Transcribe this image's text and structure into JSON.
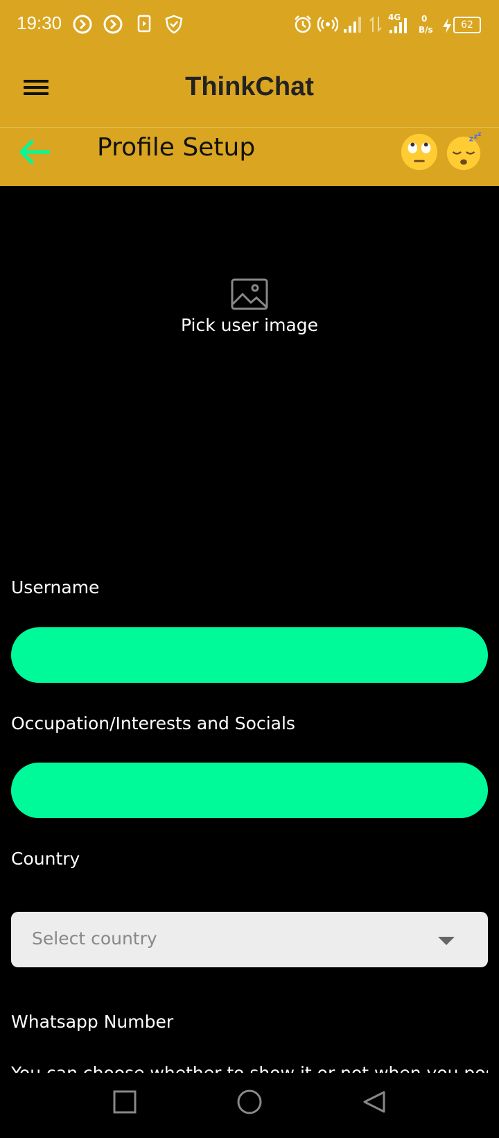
{
  "status_bar": {
    "time": "19:30",
    "network_type": "4G",
    "speed_value": "0",
    "speed_unit": "B/s",
    "battery": "62"
  },
  "app_bar": {
    "title": "ThinkChat"
  },
  "sub_bar": {
    "title": "Profile Setup"
  },
  "image_picker": {
    "label": "Pick user image"
  },
  "form": {
    "username_label": "Username",
    "username_value": "",
    "occupation_label": "Occupation/Interests and Socials",
    "occupation_value": "",
    "country_label": "Country",
    "country_placeholder": "Select country",
    "whatsapp_label": "Whatsapp Number",
    "whatsapp_hint": "You can choose whether to show it or not when you post a"
  },
  "colors": {
    "header": "#DAA520",
    "accent": "#00FA9A",
    "background": "#000000"
  },
  "icons": [
    "menu-icon",
    "back-arrow-icon",
    "eye-roll-emoji-icon",
    "sleeping-emoji-icon",
    "image-icon",
    "chevron-down-icon",
    "recents-icon",
    "home-icon",
    "back-triangle-icon"
  ]
}
